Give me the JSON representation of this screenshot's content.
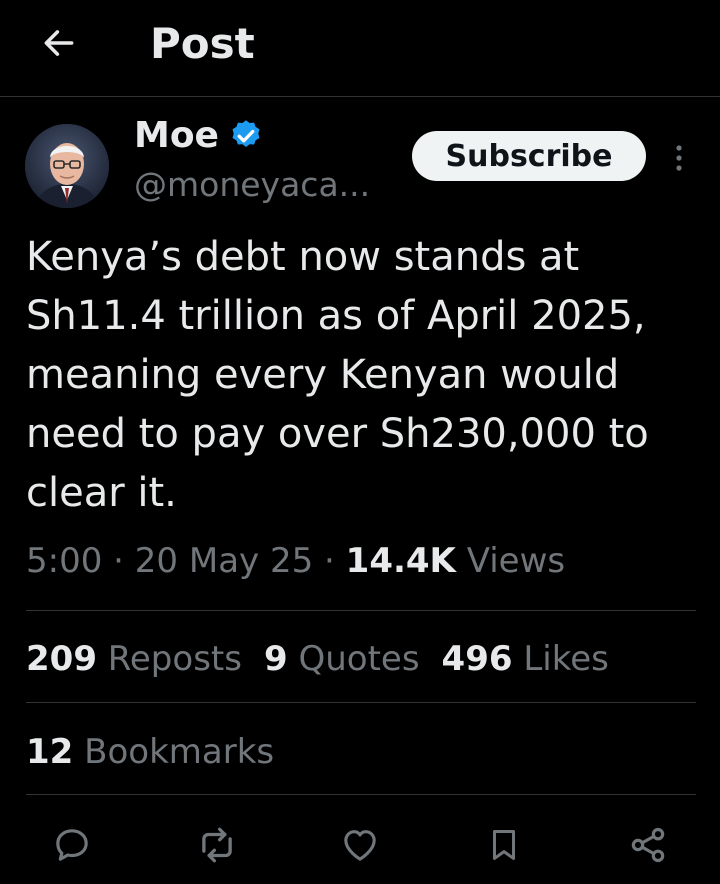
{
  "header": {
    "title": "Post",
    "back_icon": "arrow-left-icon"
  },
  "author": {
    "name": "Moe",
    "handle": "@moneyaca...",
    "verified": true,
    "verified_color": "#1d9bf0"
  },
  "subscribe_label": "Subscribe",
  "tweet": {
    "text": "Kenya’s debt now stands at Sh11.4 trillion as of April 2025, meaning every Kenyan would need to pay over Sh230,000 to clear it."
  },
  "meta": {
    "time": "5:00",
    "date": "20 May 25",
    "views_count": "14.4K",
    "views_label": "Views",
    "separator": "·"
  },
  "stats": {
    "reposts_count": "209",
    "reposts_label": "Reposts",
    "quotes_count": "9",
    "quotes_label": "Quotes",
    "likes_count": "496",
    "likes_label": "Likes",
    "bookmarks_count": "12",
    "bookmarks_label": "Bookmarks"
  },
  "actions": {
    "reply_icon": "reply-icon",
    "repost_icon": "repost-icon",
    "like_icon": "heart-icon",
    "bookmark_icon": "bookmark-icon",
    "share_icon": "share-icon"
  },
  "colors": {
    "background": "#000000",
    "text_primary": "#e7e9ea",
    "text_secondary": "#71767b",
    "divider": "#2f3336"
  }
}
